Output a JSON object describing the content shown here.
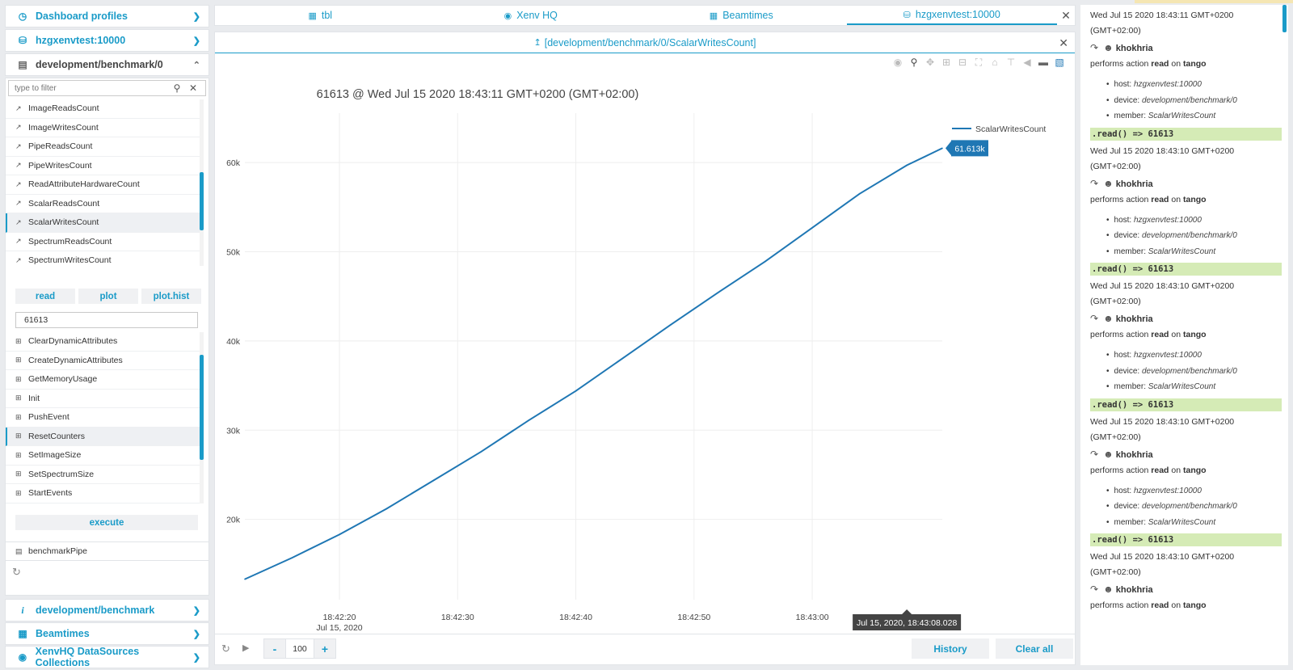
{
  "sidebar": {
    "sections": [
      {
        "icon": "dashboard-icon",
        "label": "Dashboard profiles"
      },
      {
        "icon": "database-icon",
        "label": "hzgxenvtest:10000"
      },
      {
        "icon": "device-icon",
        "label": "development/benchmark/0"
      }
    ],
    "filter_placeholder": "type to filter",
    "attributes": [
      "ImageReadsCount",
      "ImageWritesCount",
      "PipeReadsCount",
      "PipeWritesCount",
      "ReadAttributeHardwareCount",
      "ScalarReadsCount",
      "ScalarWritesCount",
      "SpectrumReadsCount",
      "SpectrumWritesCount"
    ],
    "selected_attribute": "ScalarWritesCount",
    "buttons": {
      "read": "read",
      "plot": "plot",
      "plot_hist": "plot.hist"
    },
    "value": "61613",
    "commands": [
      "ClearDynamicAttributes",
      "CreateDynamicAttributes",
      "GetMemoryUsage",
      "Init",
      "PushEvent",
      "ResetCounters",
      "SetImageSize",
      "SetSpectrumSize",
      "StartEvents"
    ],
    "selected_command": "ResetCounters",
    "execute": "execute",
    "pipe": "benchmarkPipe",
    "bottom_sections": [
      {
        "icon": "info-icon",
        "label": "development/benchmark"
      },
      {
        "icon": "table-icon",
        "label": "Beamtimes"
      },
      {
        "icon": "collections-icon",
        "label": "XenvHQ DataSources Collections"
      }
    ]
  },
  "tabs": [
    {
      "icon": "table-icon",
      "label": "tbl"
    },
    {
      "icon": "hq-icon",
      "label": "Xenv HQ"
    },
    {
      "icon": "table-icon",
      "label": "Beamtimes"
    },
    {
      "icon": "database-icon",
      "label": "hzgxenvtest:10000"
    }
  ],
  "plot_tab": {
    "label": "[development/benchmark/0/ScalarWritesCount]"
  },
  "chart_data": {
    "type": "line",
    "title": "61613 @ Wed Jul 15 2020 18:43:11 GMT+0200 (GMT+02:00)",
    "series": [
      {
        "name": "ScalarWritesCount",
        "color": "#1f77b4",
        "x": [
          "18:42:12",
          "18:42:16",
          "18:42:20",
          "18:42:24",
          "18:42:28",
          "18:42:32",
          "18:42:36",
          "18:42:40",
          "18:42:44",
          "18:42:48",
          "18:42:52",
          "18:42:56",
          "18:43:00",
          "18:43:04",
          "18:43:08",
          "18:43:11"
        ],
        "y": [
          13300,
          15700,
          18300,
          21200,
          24400,
          27600,
          31100,
          34400,
          38100,
          41800,
          45400,
          48900,
          52700,
          56500,
          59700,
          61613
        ]
      }
    ],
    "x_ticks": [
      "18:42:20",
      "18:42:30",
      "18:42:40",
      "18:42:50",
      "18:43:00"
    ],
    "x_tick_date": "Jul 15, 2020",
    "y_ticks": [
      "20k",
      "30k",
      "40k",
      "50k",
      "60k"
    ],
    "ylim": [
      11000,
      65000
    ],
    "hover_x_label": "Jul 15, 2020, 18:43:08.028",
    "hover_y_label": "61.613k",
    "legend_position": "top-right",
    "grid": true
  },
  "bottom": {
    "stepper_minus": "-",
    "stepper_value": "100",
    "stepper_plus": "+",
    "history": "History",
    "clear_all": "Clear all"
  },
  "log": [
    {
      "date": "Wed Jul 15 2020 18:43:11 GMT+0200 (GMT+02:00)",
      "user": "khokhria",
      "action_prefix": "performs action",
      "action": "read",
      "action_mid": "on",
      "target": "tango",
      "host_label": "host:",
      "host": "hzgxenvtest:10000",
      "device_label": "device:",
      "device": "development/benchmark/0",
      "member_label": "member:",
      "member": "ScalarWritesCount",
      "result": ".read() => 61613"
    },
    {
      "date": "Wed Jul 15 2020 18:43:10 GMT+0200 (GMT+02:00)",
      "user": "khokhria",
      "action_prefix": "performs action",
      "action": "read",
      "action_mid": "on",
      "target": "tango",
      "host_label": "host:",
      "host": "hzgxenvtest:10000",
      "device_label": "device:",
      "device": "development/benchmark/0",
      "member_label": "member:",
      "member": "ScalarWritesCount",
      "result": ".read() => 61613"
    },
    {
      "date": "Wed Jul 15 2020 18:43:10 GMT+0200 (GMT+02:00)",
      "user": "khokhria",
      "action_prefix": "performs action",
      "action": "read",
      "action_mid": "on",
      "target": "tango",
      "host_label": "host:",
      "host": "hzgxenvtest:10000",
      "device_label": "device:",
      "device": "development/benchmark/0",
      "member_label": "member:",
      "member": "ScalarWritesCount",
      "result": ".read() => 61613"
    },
    {
      "date": "Wed Jul 15 2020 18:43:10 GMT+0200 (GMT+02:00)",
      "user": "khokhria",
      "action_prefix": "performs action",
      "action": "read",
      "action_mid": "on",
      "target": "tango",
      "host_label": "host:",
      "host": "hzgxenvtest:10000",
      "device_label": "device:",
      "device": "development/benchmark/0",
      "member_label": "member:",
      "member": "ScalarWritesCount",
      "result": ".read() => 61613"
    },
    {
      "date": "Wed Jul 15 2020 18:43:10 GMT+0200 (GMT+02:00)",
      "user": "khokhria",
      "action_prefix": "performs action",
      "action": "read",
      "action_mid": "on",
      "target": "tango"
    }
  ]
}
